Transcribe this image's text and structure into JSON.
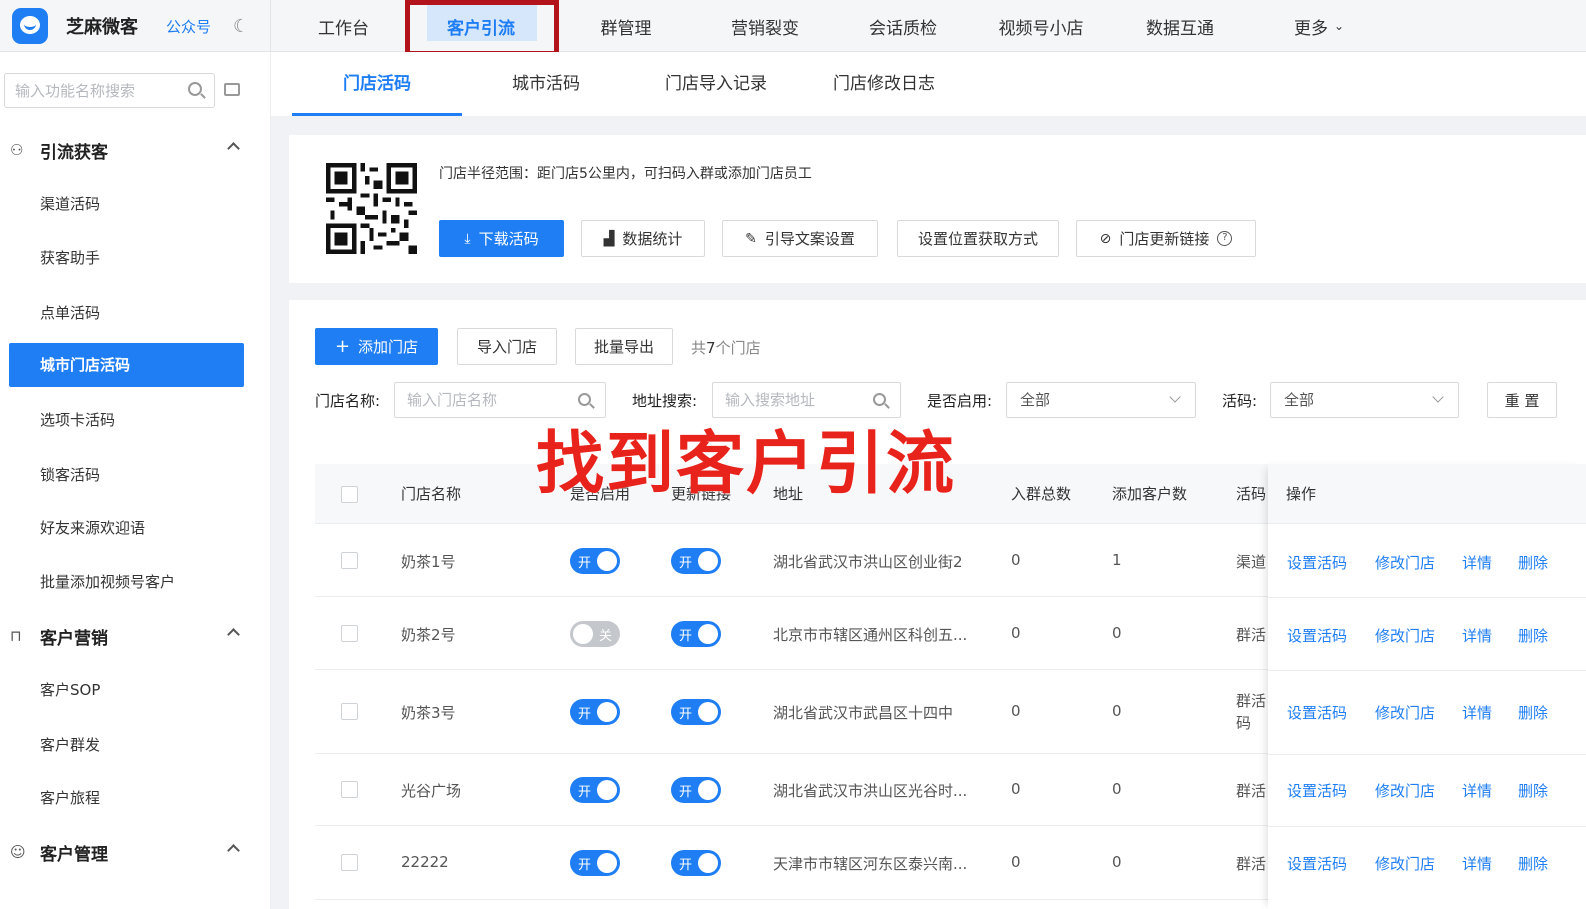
{
  "brand": {
    "name": "芝麻微客",
    "sub": "公众号",
    "theme_icon": "moon-icon"
  },
  "topnav": [
    "工作台",
    "客户引流",
    "群管理",
    "营销裂变",
    "会话质检",
    "视频号小店",
    "数据互通",
    "更多"
  ],
  "sidebar": {
    "search_placeholder": "输入功能名称搜索",
    "groups": [
      {
        "label": "引流获客",
        "icon": "user-add-icon",
        "items": [
          "渠道活码",
          "获客助手",
          "点单活码",
          "城市门店活码",
          "选项卡活码",
          "锁客活码",
          "好友来源欢迎语",
          "批量添加视频号客户"
        ]
      },
      {
        "label": "客户营销",
        "icon": "bookmark-icon",
        "items": [
          "客户SOP",
          "客户群发",
          "客户旅程"
        ]
      },
      {
        "label": "客户管理",
        "icon": "users-icon",
        "items": []
      }
    ],
    "active_item": "城市门店活码"
  },
  "subtabs": [
    "门店活码",
    "城市活码",
    "门店导入记录",
    "门店修改日志"
  ],
  "info": {
    "tip": "门店半径范围：距门店5公里内，可扫码入群或添加门店员工",
    "buttons": [
      "下载活码",
      "数据统计",
      "引导文案设置",
      "设置位置获取方式",
      "门店更新链接"
    ]
  },
  "toolbar": {
    "add": "添加门店",
    "import": "导入门店",
    "export": "批量导出",
    "count_prefix": "共",
    "count_value": "7",
    "count_suffix": "个门店"
  },
  "filters": {
    "name_label": "门店名称:",
    "name_placeholder": "输入门店名称",
    "addr_label": "地址搜索:",
    "addr_placeholder": "输入搜索地址",
    "enabled_label": "是否启用:",
    "enabled_value": "全部",
    "code_label": "活码:",
    "code_value": "全部",
    "reset": "重 置"
  },
  "overlay": "找到客户引流",
  "table": {
    "headers": [
      "门店名称",
      "是否启用",
      "更新链接",
      "地址",
      "入群总数",
      "添加客户数",
      "活码",
      "操作"
    ],
    "rows": [
      {
        "name": "奶茶1号",
        "enabled": "开",
        "link": "开",
        "address": "湖北省武汉市洪山区创业街2",
        "group_total": "0",
        "added": "1",
        "code": "渠道"
      },
      {
        "name": "奶茶2号",
        "enabled": "关",
        "link": "开",
        "address": "北京市市辖区通州区科创五...",
        "group_total": "0",
        "added": "0",
        "code": "群活"
      },
      {
        "name": "奶茶3号",
        "enabled": "开",
        "link": "开",
        "address": "湖北省武汉市武昌区十四中",
        "group_total": "0",
        "added": "0",
        "code": "群活\n码"
      },
      {
        "name": "光谷广场",
        "enabled": "开",
        "link": "开",
        "address": "湖北省武汉市洪山区光谷时...",
        "group_total": "0",
        "added": "0",
        "code": "群活"
      },
      {
        "name": "22222",
        "enabled": "开",
        "link": "开",
        "address": "天津市市辖区河东区泰兴南...",
        "group_total": "0",
        "added": "0",
        "code": "群活"
      }
    ],
    "ops": [
      "设置活码",
      "修改门店",
      "详情",
      "删除"
    ]
  },
  "colors": {
    "primary": "#1f7ef3",
    "highlight_border": "#b3141b",
    "overlay_text": "#e8231b"
  }
}
